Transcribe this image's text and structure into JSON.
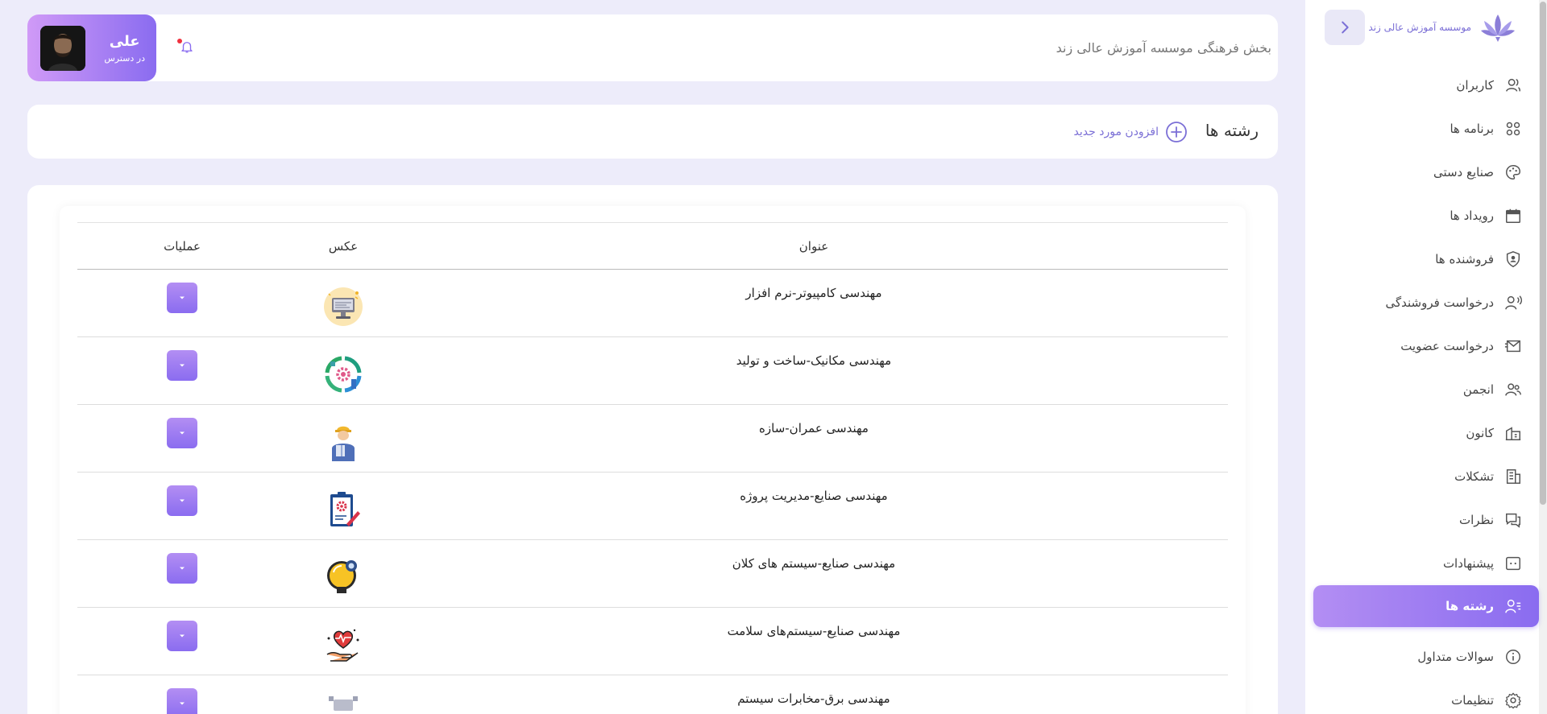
{
  "brand": {
    "name": "موسسه آموزش عالی زند",
    "logo_icon": "lotus-logo-icon"
  },
  "sidebar": {
    "collapse_icon": "chevron-right-icon",
    "items": [
      {
        "label": "کاربران",
        "icon": "user-icon",
        "active": false
      },
      {
        "label": "برنامه ها",
        "icon": "apps-grid-icon",
        "active": false
      },
      {
        "label": "صنایع دستی",
        "icon": "palette-icon",
        "active": false
      },
      {
        "label": "رویداد ها",
        "icon": "calendar-icon",
        "active": false
      },
      {
        "label": "فروشنده ها",
        "icon": "shield-user-icon",
        "active": false
      },
      {
        "label": "درخواست فروشندگی",
        "icon": "user-voice-icon",
        "active": false
      },
      {
        "label": "درخواست عضویت",
        "icon": "mail-send-icon",
        "active": false
      },
      {
        "label": "انجمن",
        "icon": "users-icon",
        "active": false
      },
      {
        "label": "کانون",
        "icon": "building-icon",
        "active": false
      },
      {
        "label": "تشکلات",
        "icon": "office-icon",
        "active": false
      },
      {
        "label": "نظرات",
        "icon": "chat-icon",
        "active": false
      },
      {
        "label": "پیشنهادات",
        "icon": "message-dots-icon",
        "active": false
      },
      {
        "label": "رشته ها",
        "icon": "user-list-icon",
        "active": true
      },
      {
        "label": "سوالات متداول",
        "icon": "info-icon",
        "active": false
      },
      {
        "label": "تنظیمات",
        "icon": "gear-icon",
        "active": false
      }
    ]
  },
  "header": {
    "title": "بخش فرهنگی موسسه آموزش عالی زند",
    "notification_icon": "bell-icon",
    "profile": {
      "name": "علی",
      "status": "در دسترس"
    }
  },
  "page": {
    "title": "رشته ها",
    "add_label": "افزودن مورد جدید",
    "add_icon": "plus-circle-icon"
  },
  "table": {
    "headers": {
      "title": "عنوان",
      "image": "عکس",
      "actions": "عملیات"
    },
    "rows": [
      {
        "title": "مهندسی کامپیوتر-نرم افزار",
        "image_icon": "computer-icon"
      },
      {
        "title": "مهندسی مکانیک-ساخت و تولید",
        "image_icon": "gear-cycle-icon"
      },
      {
        "title": "مهندسی عمران-سازه",
        "image_icon": "engineer-icon"
      },
      {
        "title": "مهندسی صنایع-مدیریت پروژه",
        "image_icon": "clipboard-gear-icon"
      },
      {
        "title": "مهندسی صنایع-سیستم های کلان",
        "image_icon": "bulb-gear-icon"
      },
      {
        "title": "مهندسی صنایع-سیستم‌های سلامت",
        "image_icon": "heart-hand-icon"
      },
      {
        "title": "مهندسی برق-مخابرات سیستم",
        "image_icon": "circuit-icon"
      }
    ],
    "action_icon": "caret-down-icon"
  },
  "colors": {
    "accent": "#8a6cf0",
    "accent_light": "#b38ef3",
    "background": "#edecfa",
    "brand_text": "#7b6fd6"
  }
}
